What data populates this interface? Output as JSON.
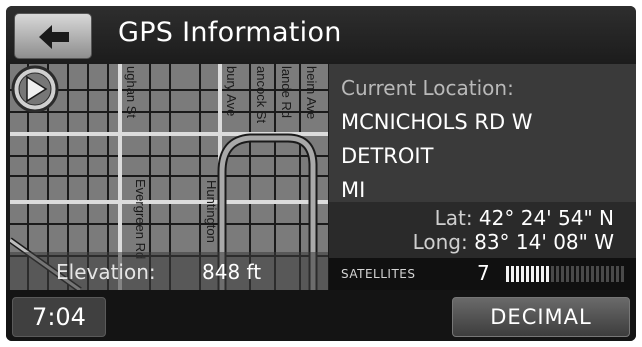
{
  "header": {
    "title": "GPS Information",
    "back_icon": "arrow-left-icon"
  },
  "map": {
    "street_labels": [
      "ughan St",
      "Evergreen Rd",
      "Huntington",
      "bury Ave",
      "ancock St",
      "lande Rd",
      "heim Ave"
    ],
    "elevation_label": "Elevation:",
    "elevation_value": "848 ft",
    "marker_icon": "vehicle-position-arrow-icon"
  },
  "location": {
    "label": "Current Location:",
    "street": "MCNICHOLS RD W",
    "city": "DETROIT",
    "state": "MI",
    "lat_label": "Lat:",
    "lat_value": "42° 24' 54\" N",
    "long_label": "Long:",
    "long_value": "83° 14' 08\" W"
  },
  "satellites": {
    "label": "SATELLITES",
    "count": "7",
    "signal_bars_total": 24,
    "signal_bars_active": 9
  },
  "footer": {
    "time": "7:04",
    "decimal_button": "DECIMAL"
  },
  "colors": {
    "screen_bg": "#1b1b1b",
    "info_bg": "#3a3a3a",
    "map_bg": "#7b7b7b",
    "text": "#ffffff"
  }
}
